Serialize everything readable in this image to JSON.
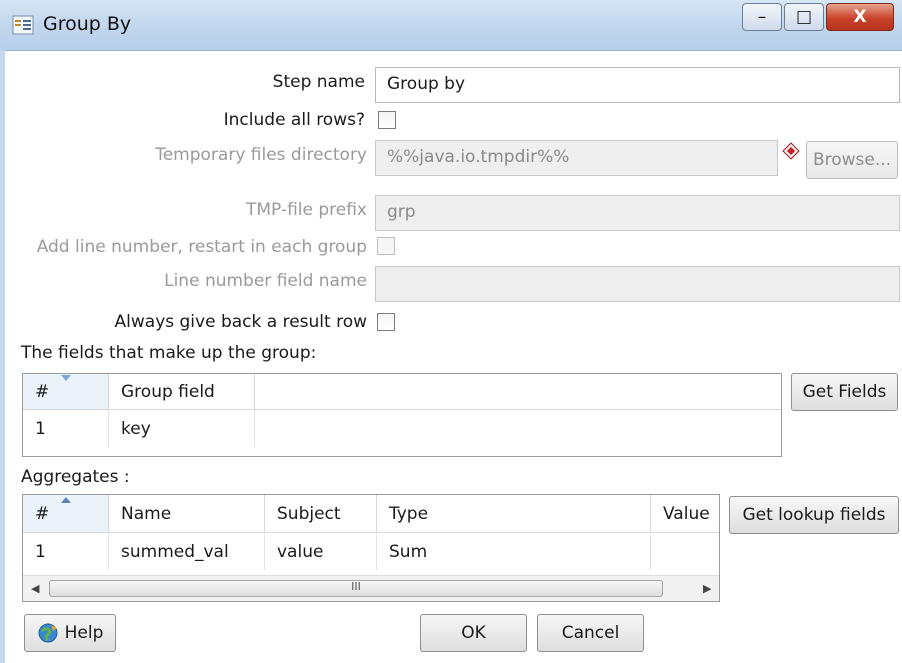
{
  "window": {
    "title": "Group By",
    "icon": "group-by-icon",
    "controls": {
      "minimize": "–",
      "maximize": "□",
      "close": "X"
    }
  },
  "form": {
    "step_name": {
      "label": "Step name",
      "value": "Group by"
    },
    "include_all_rows": {
      "label": "Include all rows?",
      "checked": false
    },
    "temp_dir": {
      "label": "Temporary files directory",
      "value": "%%java.io.tmpdir%%",
      "browse": "Browse...",
      "variable_icon": "variable-diamond-icon"
    },
    "tmp_prefix": {
      "label": "TMP-file prefix",
      "value": "grp"
    },
    "add_line_number": {
      "label": "Add line number, restart in each group",
      "checked": false
    },
    "line_number_field": {
      "label": "Line number field name",
      "value": ""
    },
    "always_result_row": {
      "label": "Always give back a result row",
      "checked": false
    }
  },
  "group_section": {
    "title": "The fields that make up the group:",
    "get_fields": "Get Fields",
    "columns": [
      "#",
      "Group field"
    ],
    "rows": [
      {
        "num": "1",
        "field": "key"
      }
    ]
  },
  "aggregates_section": {
    "title": "Aggregates :",
    "get_lookup": "Get lookup fields",
    "columns": [
      "#",
      "Name",
      "Subject",
      "Type",
      "Value"
    ],
    "rows": [
      {
        "num": "1",
        "name": "summed_val",
        "subject": "value",
        "type": "Sum",
        "value": ""
      }
    ],
    "scroll_grip": "III"
  },
  "buttons": {
    "help": "Help",
    "ok": "OK",
    "cancel": "Cancel"
  }
}
